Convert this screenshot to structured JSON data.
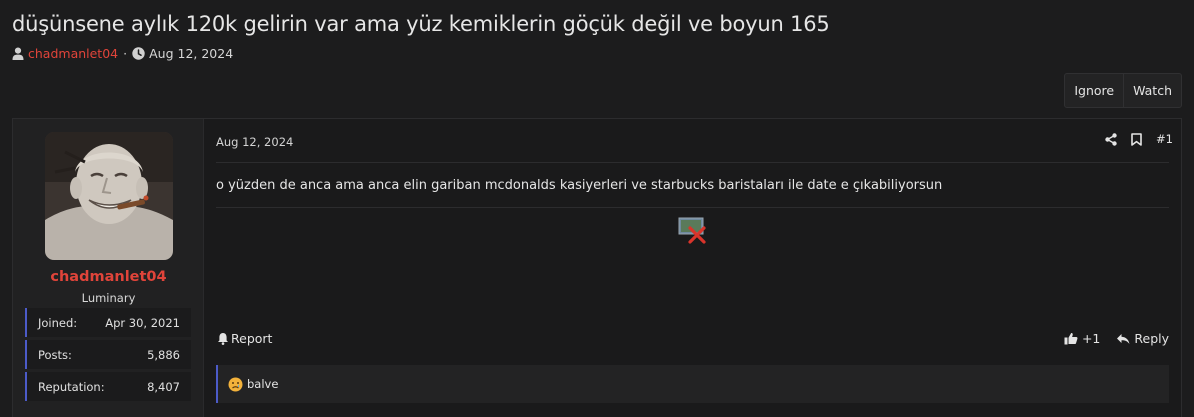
{
  "thread": {
    "title": "düşünsene aylık 120k gelirin var ama yüz kemiklerin göçük değil ve boyun 165",
    "author": "chadmanlet04",
    "separator": "·",
    "date": "Aug 12, 2024"
  },
  "buttons": {
    "ignore": "Ignore",
    "watch": "Watch"
  },
  "user": {
    "name": "chadmanlet04",
    "title": "Luminary",
    "stats": [
      {
        "label": "Joined:",
        "value": "Apr 30, 2021"
      },
      {
        "label": "Posts:",
        "value": "5,886"
      },
      {
        "label": "Reputation:",
        "value": "8,407"
      }
    ]
  },
  "post": {
    "date": "Aug 12, 2024",
    "number": "#1",
    "body": "o yüzden de anca ama anca elin gariban mcdonalds kasiyerleri ve starbucks baristaları ile date e çıkabiliyorsun",
    "report_label": "Report",
    "like_count": "+1",
    "reply_label": "Reply"
  },
  "reactions": {
    "text": "balve",
    "icon": "sad-face-emoji"
  },
  "colors": {
    "accent": "#e0443a",
    "stat_border": "#4c5bc8",
    "background": "#1c1c1d"
  }
}
